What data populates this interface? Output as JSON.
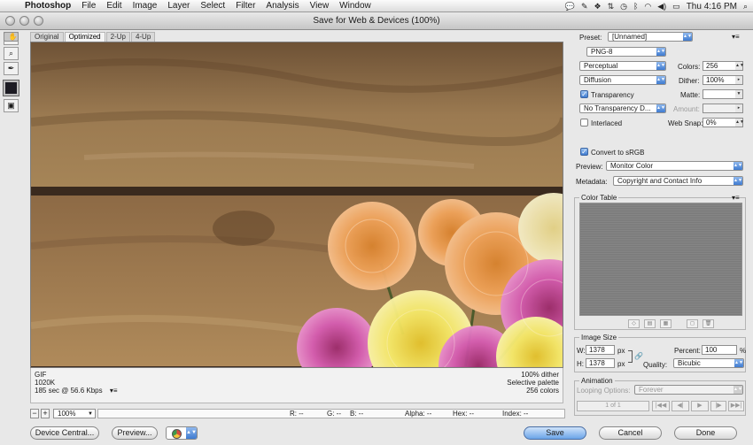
{
  "menubar": {
    "app": "Photoshop",
    "items": [
      "File",
      "Edit",
      "Image",
      "Layer",
      "Select",
      "Filter",
      "Analysis",
      "View",
      "Window"
    ],
    "clock": "Thu 4:16 PM"
  },
  "window": {
    "title": "Save for Web & Devices (100%)"
  },
  "tabs": [
    "Original",
    "Optimized",
    "2-Up",
    "4-Up"
  ],
  "info": {
    "format": "GIF",
    "size": "1020K",
    "download": "185 sec @ 56.6 Kbps",
    "dither": "100% dither",
    "palette": "Selective palette",
    "colors": "256 colors"
  },
  "status": {
    "zoom_minus": "−",
    "zoom_plus": "+",
    "zoom": "100%",
    "r": "R: --",
    "g": "G: --",
    "b": "B: --",
    "alpha": "Alpha: --",
    "hex": "Hex: --",
    "index": "Index: --"
  },
  "buttons": {
    "device_central": "Device Central...",
    "preview": "Preview...",
    "save": "Save",
    "cancel": "Cancel",
    "done": "Done"
  },
  "settings": {
    "preset_label": "Preset:",
    "preset": "[Unnamed]",
    "format": "PNG-8",
    "reduction": "Perceptual",
    "colors_label": "Colors:",
    "colors": "256",
    "dither_algo": "Diffusion",
    "dither_label": "Dither:",
    "dither": "100%",
    "transparency": "Transparency",
    "matte_label": "Matte:",
    "transparency_dither": "No Transparency D...",
    "amount_label": "Amount:",
    "interlaced": "Interlaced",
    "websnap_label": "Web Snap:",
    "websnap": "0%",
    "convert_srgb": "Convert to sRGB",
    "preview_label": "Preview:",
    "preview": "Monitor Color",
    "metadata_label": "Metadata:",
    "metadata": "Copyright and Contact Info"
  },
  "color_table": {
    "title": "Color Table"
  },
  "image_size": {
    "title": "Image Size",
    "w_label": "W:",
    "w": "1378",
    "h_label": "H:",
    "h": "1378",
    "unit": "px",
    "percent_label": "Percent:",
    "percent": "100",
    "percent_unit": "%",
    "quality_label": "Quality:",
    "quality": "Bicubic"
  },
  "animation": {
    "title": "Animation",
    "looping_label": "Looping Options:",
    "looping": "Forever",
    "frame": "1 of 1"
  }
}
